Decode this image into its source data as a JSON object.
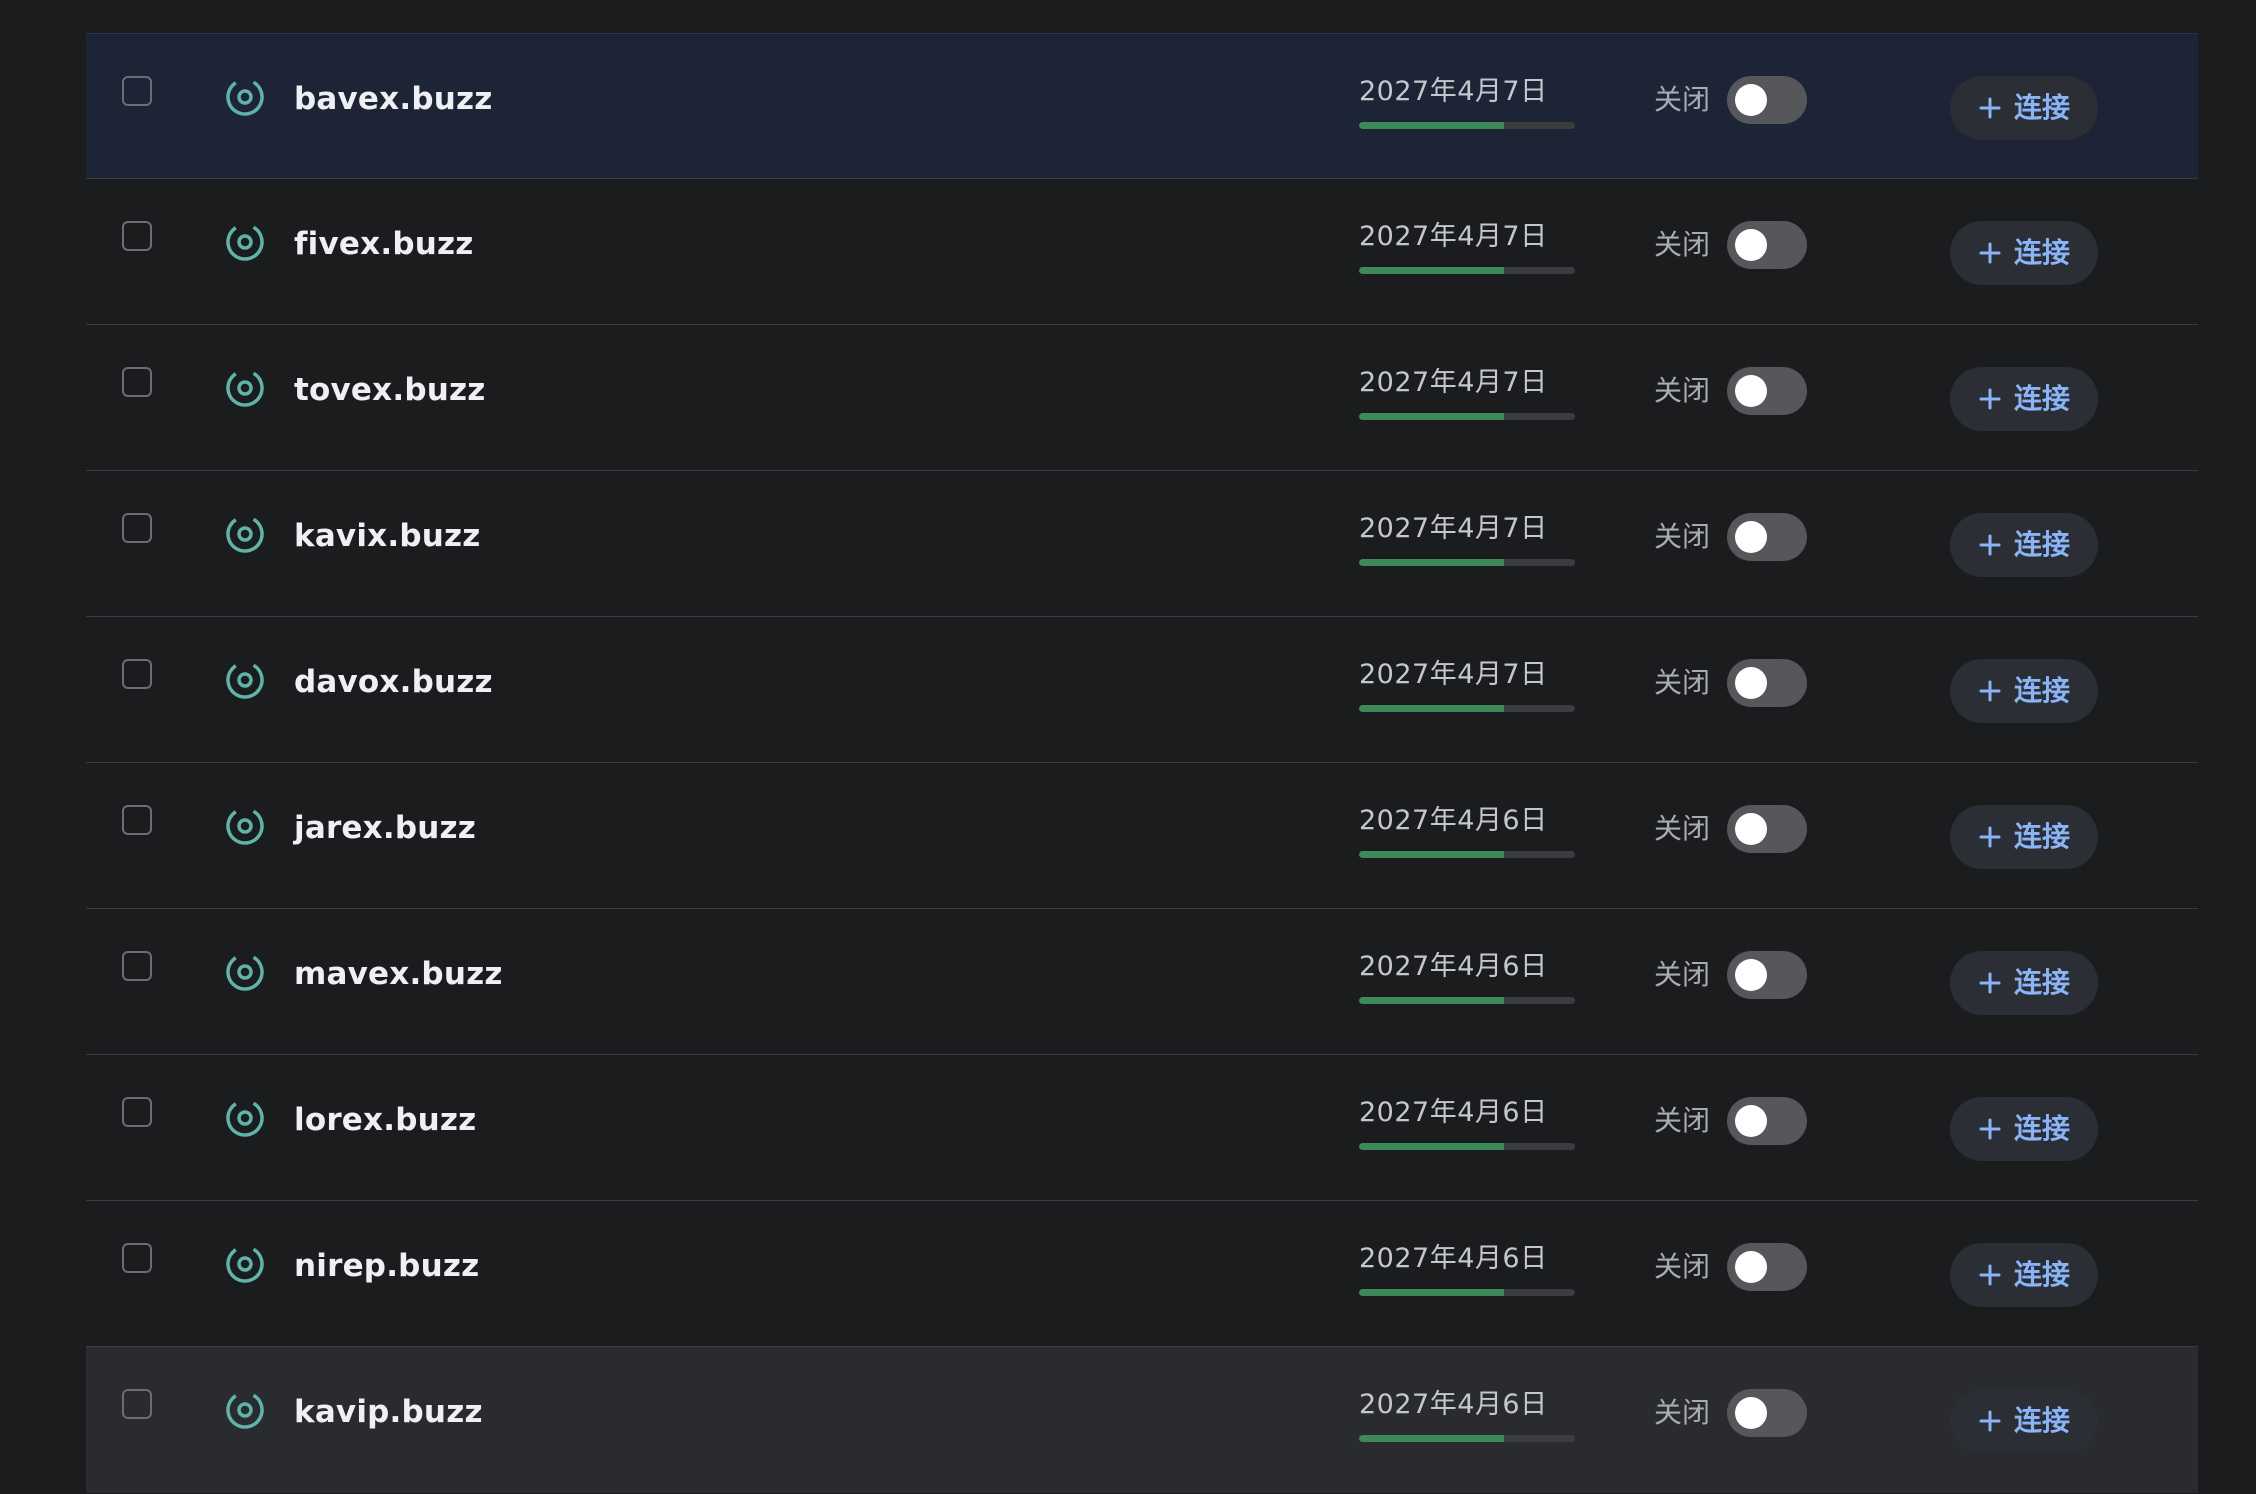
{
  "domains": [
    {
      "name": "bavex.buzz",
      "expiry": "2027年4月7日",
      "progress": 0.67,
      "toggle_label": "关闭",
      "toggle_on": false,
      "connect_label": "连接"
    },
    {
      "name": "fivex.buzz",
      "expiry": "2027年4月7日",
      "progress": 0.67,
      "toggle_label": "关闭",
      "toggle_on": false,
      "connect_label": "连接"
    },
    {
      "name": "tovex.buzz",
      "expiry": "2027年4月7日",
      "progress": 0.67,
      "toggle_label": "关闭",
      "toggle_on": false,
      "connect_label": "连接"
    },
    {
      "name": "kavix.buzz",
      "expiry": "2027年4月7日",
      "progress": 0.67,
      "toggle_label": "关闭",
      "toggle_on": false,
      "connect_label": "连接"
    },
    {
      "name": "davox.buzz",
      "expiry": "2027年4月7日",
      "progress": 0.67,
      "toggle_label": "关闭",
      "toggle_on": false,
      "connect_label": "连接"
    },
    {
      "name": "jarex.buzz",
      "expiry": "2027年4月6日",
      "progress": 0.67,
      "toggle_label": "关闭",
      "toggle_on": false,
      "connect_label": "连接"
    },
    {
      "name": "mavex.buzz",
      "expiry": "2027年4月6日",
      "progress": 0.67,
      "toggle_label": "关闭",
      "toggle_on": false,
      "connect_label": "连接"
    },
    {
      "name": "lorex.buzz",
      "expiry": "2027年4月6日",
      "progress": 0.67,
      "toggle_label": "关闭",
      "toggle_on": false,
      "connect_label": "连接"
    },
    {
      "name": "nirep.buzz",
      "expiry": "2027年4月6日",
      "progress": 0.67,
      "toggle_label": "关闭",
      "toggle_on": false,
      "connect_label": "连接"
    },
    {
      "name": "kavip.buzz",
      "expiry": "2027年4月6日",
      "progress": 0.67,
      "toggle_label": "关闭",
      "toggle_on": false,
      "connect_label": "连接"
    }
  ],
  "icons": {
    "domain": "globe-target-icon",
    "connect": "plus-icon"
  },
  "colors": {
    "background": "#1b1c1e",
    "selected_row": "#1d2436",
    "hovered_row": "#2a2b2e",
    "icon_teal": "#5fb3a8",
    "progress_fill": "#3b8a57",
    "connect_text": "#8ab4f8",
    "toggle_off": "#55575b"
  }
}
